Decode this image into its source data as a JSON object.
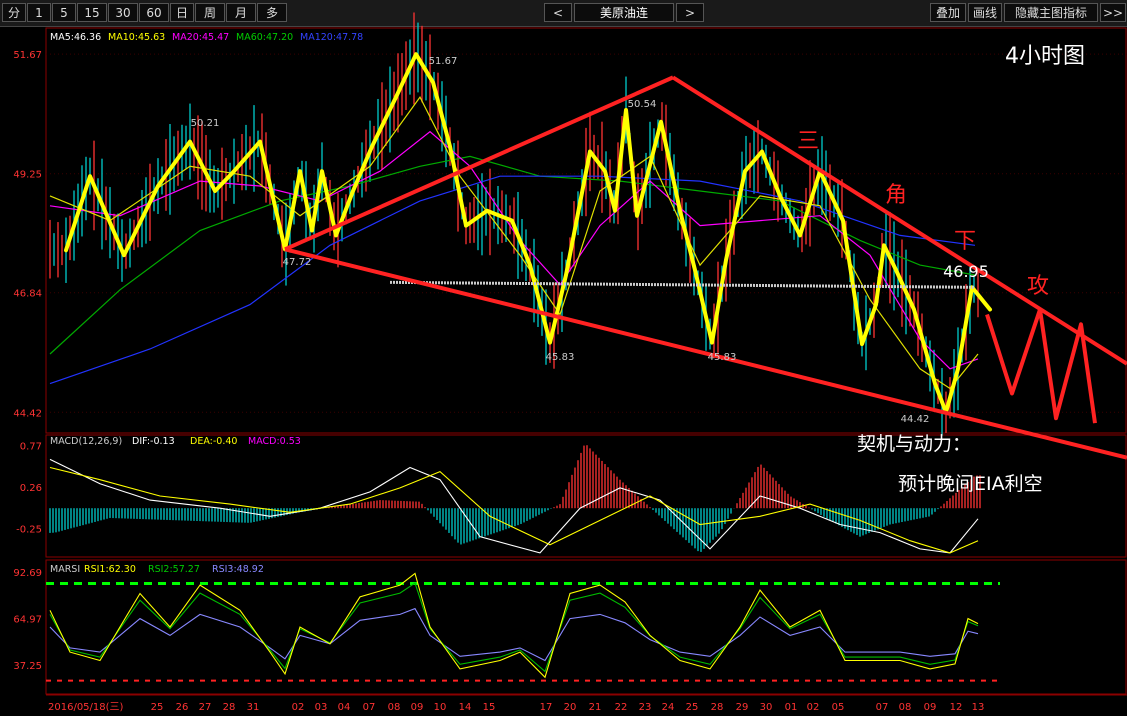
{
  "toolbar": {
    "periods": [
      "分",
      "1",
      "5",
      "15",
      "30",
      "60",
      "日",
      "周",
      "月",
      "多"
    ],
    "prev": "<",
    "title": "美原油连",
    "next": ">",
    "right": [
      "叠加",
      "画线",
      "隐藏主图指标",
      ">>"
    ]
  },
  "main": {
    "ma_legend": [
      {
        "text": "MA5:46.36",
        "color": "#ffffff"
      },
      {
        "text": "MA10:45.63",
        "color": "#ffff00"
      },
      {
        "text": "MA20:45.47",
        "color": "#ff00ff"
      },
      {
        "text": "MA60:47.20",
        "color": "#00cc00"
      },
      {
        "text": "MA120:47.78",
        "color": "#3344ff"
      }
    ],
    "y_ticks": [
      "51.67",
      "49.25",
      "46.84",
      "44.42"
    ],
    "timeframe_label": "4小时图",
    "price_labels": [
      "50.21",
      "51.67",
      "50.54",
      "47.72",
      "45.83",
      "45.83",
      "44.42"
    ],
    "last_price": "46.95",
    "pattern_chars": [
      "三",
      "角",
      "下",
      "攻"
    ],
    "notes": [
      "契机与动力：",
      "预计晚间EIA利空"
    ]
  },
  "macd": {
    "legend": [
      {
        "text": "MACD(12,26,9)",
        "color": "#cccccc"
      },
      {
        "text": "DIF:-0.13",
        "color": "#ffffff"
      },
      {
        "text": "DEA:-0.40",
        "color": "#ffff00"
      },
      {
        "text": "MACD:0.53",
        "color": "#ff00ff"
      }
    ],
    "y_ticks": [
      "0.77",
      "0.26",
      "-0.25"
    ]
  },
  "rsi": {
    "legend": [
      {
        "text": "MARSI",
        "color": "#cccccc"
      },
      {
        "text": "RSI1:62.30",
        "color": "#ffff00"
      },
      {
        "text": "RSI2:57.27",
        "color": "#00cc00"
      },
      {
        "text": "RSI3:48.92",
        "color": "#8888ff"
      }
    ],
    "y_ticks": [
      "92.69",
      "64.97",
      "37.25"
    ]
  },
  "x_axis": {
    "labels": [
      "2016/05/18(三)",
      "25",
      "26",
      "27",
      "28",
      "31",
      "02",
      "03",
      "04",
      "07",
      "08",
      "09",
      "10",
      "14",
      "15",
      "17",
      "20",
      "21",
      "22",
      "23",
      "24",
      "25",
      "28",
      "29",
      "30",
      "01",
      "02",
      "05",
      "07",
      "08",
      "09",
      "12",
      "13"
    ]
  },
  "chart_data": {
    "type": "line",
    "title": "美原油连",
    "subtitle": "4小时图",
    "ylim": [
      44.0,
      52.2
    ],
    "x": [
      "2016/05/18",
      "25",
      "26",
      "27",
      "28",
      "31",
      "02",
      "03",
      "04",
      "07",
      "08",
      "09",
      "10",
      "14",
      "15",
      "17",
      "20",
      "21",
      "22",
      "23",
      "24",
      "25",
      "28",
      "29",
      "30",
      "01",
      "02",
      "05",
      "07",
      "08",
      "09",
      "12",
      "13"
    ],
    "series": [
      {
        "name": "MA5",
        "values": [
          46.36
        ]
      },
      {
        "name": "MA10",
        "values": [
          45.63
        ]
      },
      {
        "name": "MA20",
        "values": [
          45.47
        ]
      },
      {
        "name": "MA60",
        "values": [
          47.2
        ]
      },
      {
        "name": "MA120",
        "values": [
          47.78
        ]
      }
    ],
    "annotated_extremes": [
      50.21,
      51.67,
      50.54,
      47.72,
      45.83,
      45.83,
      44.42
    ],
    "last_price": 46.95,
    "macd": {
      "DIF": -0.13,
      "DEA": -0.4,
      "MACD": 0.53,
      "ylim": [
        -0.6,
        0.9
      ]
    },
    "rsi": {
      "RSI1": 62.3,
      "RSI2": 57.27,
      "RSI3": 48.92,
      "ylim": [
        20,
        100
      ]
    },
    "colors": {
      "price_line": "#ffff00",
      "trend_line": "#ff2222",
      "up_bar": "#ff3333",
      "down_bar": "#00cccc"
    }
  }
}
